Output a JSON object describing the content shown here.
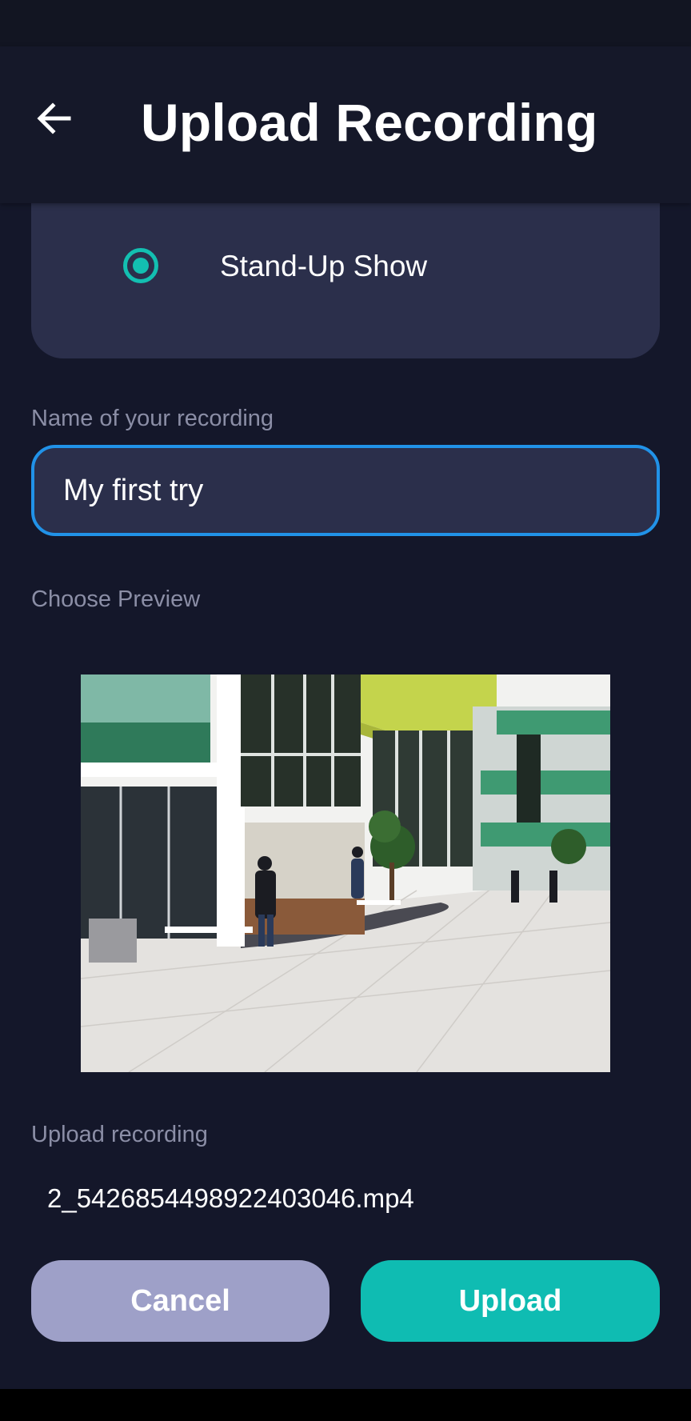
{
  "app_bar": {
    "title": "Upload Recording",
    "back_icon": "arrow-left-icon"
  },
  "category": {
    "selected_option": "Stand-Up Show",
    "radio_icon": "radio-selected-icon",
    "accent_color": "#13bfb1"
  },
  "name_field": {
    "label": "Name of your recording",
    "value": "My first try",
    "focus_color": "#2192e8"
  },
  "preview": {
    "label": "Choose Preview",
    "image_description": "interior atrium photo"
  },
  "upload": {
    "label": "Upload recording",
    "file_name": "2_5426854498922403046.mp4"
  },
  "actions": {
    "cancel_label": "Cancel",
    "upload_label": "Upload",
    "cancel_color": "#9ea0c8",
    "upload_color": "#0fbcb2"
  }
}
